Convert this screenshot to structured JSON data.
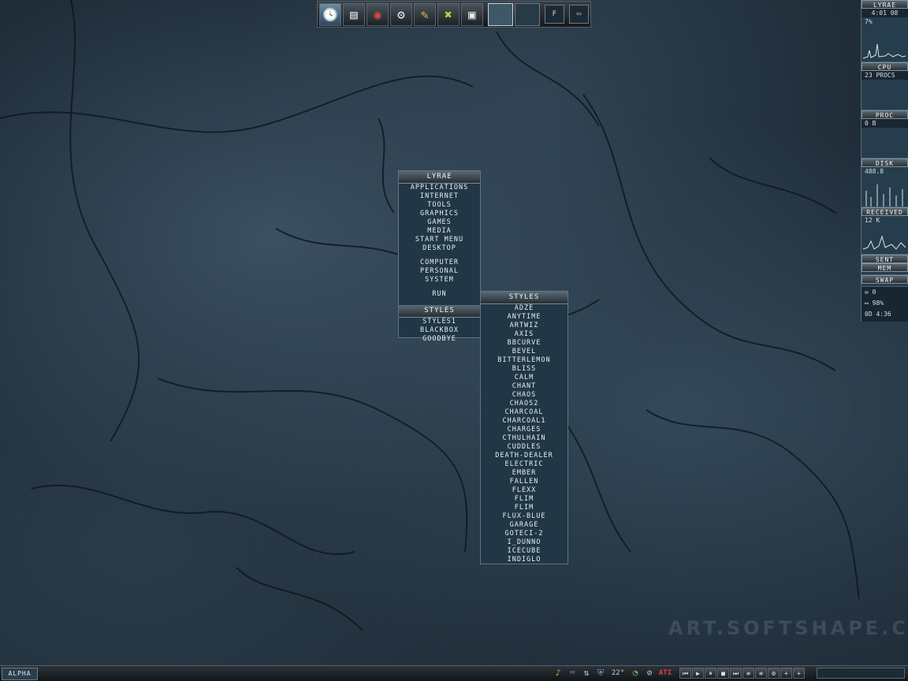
{
  "watermark": "ART.SOFTSHAPE.COM",
  "dock": {
    "icons": [
      "clock-icon",
      "folder-icon",
      "browser-icon",
      "film-reel-icon",
      "notepad-icon",
      "x-icon",
      "terminal-icon"
    ],
    "pager": [
      "1",
      "2"
    ],
    "small_btn": "F"
  },
  "root_menu": {
    "title": "LYRAE",
    "group1": [
      "APPLICATIONS",
      "INTERNET",
      "TOOLS",
      "GRAPHICS",
      "GAMES",
      "MEDIA",
      "START MENU",
      "DESKTOP"
    ],
    "group2": [
      "COMPUTER",
      "PERSONAL",
      "SYSTEM"
    ],
    "group3": [
      "RUN"
    ],
    "styles_title": "STYLES",
    "group4": [
      "STYLES1",
      "BLACKBOX",
      "GOODBYE"
    ]
  },
  "styles_menu": {
    "title": "STYLES",
    "items": [
      "ADZE",
      "ANYTIME",
      "ARTWIZ",
      "AXIS",
      "BBCURVE",
      "BEVEL",
      "BITTERLEMON",
      "BLISS",
      "CALM",
      "CHANT",
      "CHAOS",
      "CHAOS2",
      "CHARCOAL",
      "CHARCOAL1",
      "CHARGES",
      "CTHULHAIN",
      "CUDDLES",
      "DEATH-DEALER",
      "ELECTRIC",
      "EMBER",
      "FALLEN",
      "FLEXX",
      "FLIM",
      "FLIM",
      "FLUX-BLUE",
      "GARAGE",
      "GOTECI-2",
      "I_DUNNO",
      "ICECUBE",
      "INDIGLO"
    ]
  },
  "slit": {
    "host": "LYRAE",
    "time": "4:01 08",
    "cpu_percent": "7%",
    "cpu_label": "CPU",
    "procs": "23 PROCS",
    "proc_label": "PROC",
    "proc_value": "0 B",
    "disk_label": "DISK",
    "disk_value": "488.8",
    "received_label": "RECEIVED",
    "received_value": "12 K",
    "sent_label": "SENT",
    "mem_label": "MEM",
    "swap_label": "SWAP",
    "mail_count": "0",
    "battery": "98%",
    "uptime": "0D 4:36"
  },
  "toolbar": {
    "workspace": "ALPHA",
    "tray_text": "22°",
    "media_buttons": [
      "⏮",
      "▶",
      "⏸",
      "■",
      "⏭",
      "≡",
      "≡",
      "⚙",
      "+",
      "+"
    ]
  }
}
